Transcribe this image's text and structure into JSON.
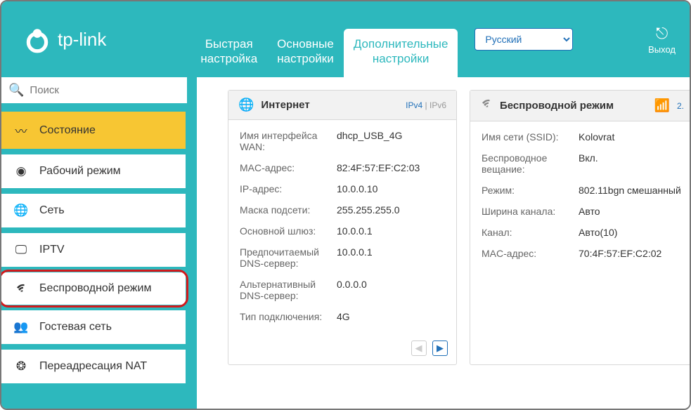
{
  "header": {
    "brand": "tp-link",
    "tabs": [
      {
        "line1": "Быстрая",
        "line2": "настройка"
      },
      {
        "line1": "Основные",
        "line2": "настройки"
      },
      {
        "line1": "Дополнительные",
        "line2": "настройки"
      }
    ],
    "language": "Русский",
    "logout": "Выход"
  },
  "sidebar": {
    "search_placeholder": "Поиск",
    "items": [
      {
        "label": "Состояние",
        "icon": "pulse-icon",
        "active": true
      },
      {
        "label": "Рабочий режим",
        "icon": "toggle-icon"
      },
      {
        "label": "Сеть",
        "icon": "globe-icon"
      },
      {
        "label": "IPTV",
        "icon": "monitor-icon"
      },
      {
        "label": "Беспроводной режим",
        "icon": "wifi-icon",
        "highlighted": true
      },
      {
        "label": "Гостевая сеть",
        "icon": "users-icon"
      },
      {
        "label": "Переадресация NAT",
        "icon": "nat-icon"
      }
    ]
  },
  "main": {
    "internet": {
      "title": "Интернет",
      "mode1": "IPv4",
      "mode2": "IPv6",
      "rows": [
        {
          "k": "Имя интерфейса WAN:",
          "v": "dhcp_USB_4G"
        },
        {
          "k": "MAC-адрес:",
          "v": "82:4F:57:EF:C2:03"
        },
        {
          "k": "IP-адрес:",
          "v": "10.0.0.10"
        },
        {
          "k": "Маска подсети:",
          "v": "255.255.255.0"
        },
        {
          "k": "Основной шлюз:",
          "v": "10.0.0.1"
        },
        {
          "k": "Предпочитаемый DNS-сервер:",
          "v": "10.0.0.1"
        },
        {
          "k": "Альтернативный DNS-сервер:",
          "v": "0.0.0.0"
        },
        {
          "k": "Тип подключения:",
          "v": "4G"
        }
      ]
    },
    "wireless": {
      "title": "Беспроводной режим",
      "band": "2.",
      "rows": [
        {
          "k": "Имя сети (SSID):",
          "v": "Kolovrat"
        },
        {
          "k": "Беспроводное вещание:",
          "v": "Вкл."
        },
        {
          "k": "Режим:",
          "v": "802.11bgn смешанный"
        },
        {
          "k": "Ширина канала:",
          "v": "Авто"
        },
        {
          "k": "Канал:",
          "v": "Авто(10)"
        },
        {
          "k": "MAC-адрес:",
          "v": "70:4F:57:EF:C2:02"
        }
      ]
    }
  }
}
